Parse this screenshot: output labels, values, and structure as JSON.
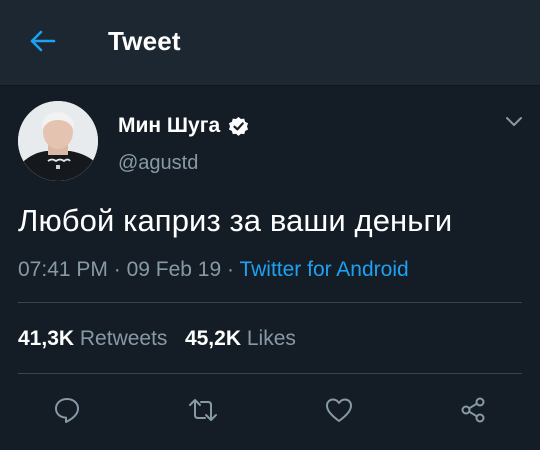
{
  "header": {
    "title": "Tweet",
    "back_icon": "arrow-left-icon",
    "accent": "#1da1f2"
  },
  "tweet": {
    "author_name": "Мин Шуга",
    "handle": "@agustd",
    "verified": true,
    "text": "Любой каприз за ваши деньги",
    "time": "07:41 PM",
    "date": "09 Feb 19",
    "separator": " · ",
    "source": "Twitter for Android"
  },
  "stats": {
    "retweets_count": "41,3K",
    "retweets_label": "Retweets",
    "likes_count": "45,2K",
    "likes_label": "Likes"
  },
  "actions": [
    "reply-icon",
    "retweet-icon",
    "like-icon",
    "share-icon"
  ],
  "colors": {
    "background": "#141d26",
    "header_bg": "#1c2732",
    "secondary_text": "#8899a6",
    "link": "#1da1f2",
    "divider": "#38444d"
  }
}
